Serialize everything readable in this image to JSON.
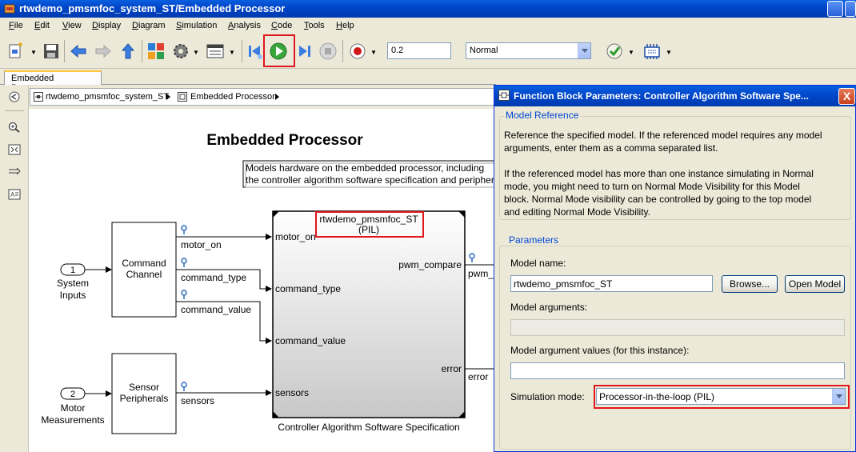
{
  "window": {
    "title": "rtwdemo_pmsmfoc_system_ST/Embedded Processor"
  },
  "menu": [
    "File",
    "Edit",
    "View",
    "Display",
    "Diagram",
    "Simulation",
    "Analysis",
    "Code",
    "Tools",
    "Help"
  ],
  "toolbar": {
    "stop_time": "0.2",
    "sim_mode": "Normal"
  },
  "tab": {
    "label": "Embedded Processor"
  },
  "breadcrumb": [
    "rtwdemo_pmsmfoc_system_ST",
    "Embedded Processor"
  ],
  "diagram": {
    "title": "Embedded Processor",
    "annotation_line1": "Models hardware on the embedded processor, including",
    "annotation_line2": "the controller algorithm software specification and peripher",
    "inport1_num": "1",
    "inport1_label_a": "System",
    "inport1_label_b": "Inputs",
    "inport2_num": "2",
    "inport2_label_a": "Motor",
    "inport2_label_b": "Measurements",
    "cmd_block_a": "Command",
    "cmd_block_b": "Channel",
    "sensor_block_a": "Sensor",
    "sensor_block_b": "Peripherals",
    "signal_motor_on": "motor_on",
    "signal_command_type": "command_type",
    "signal_command_value": "command_value",
    "signal_sensors": "sensors",
    "model_ref_name": "rtwdemo_pmsmfoc_ST",
    "model_ref_mode": "(PIL)",
    "port_in_motor_on": "motor_on",
    "port_in_command_type": "command_type",
    "port_in_command_value": "command_value",
    "port_in_sensors": "sensors",
    "port_out_pwm": "pwm_compare",
    "port_out_error": "error",
    "out_sig_pwm": "pwm_",
    "out_sig_error": "error",
    "model_block_caption": "Controller Algorithm Software Specification"
  },
  "dialog": {
    "title": "Function Block Parameters: Controller Algorithm Software Spe...",
    "close": "X",
    "group1_title": "Model Reference",
    "desc1_l1": "Reference the specified model. If the referenced model requires any model",
    "desc1_l2": "arguments, enter them as a comma separated list.",
    "desc2_l1": "If the referenced model has more than one instance simulating in Normal",
    "desc2_l2": "mode, you might need to turn on Normal Mode Visibility for this Model",
    "desc2_l3": "block. Normal Mode visibility can be controlled by going to the top model",
    "desc2_l4": "and editing Normal Mode Visibility.",
    "group2_title": "Parameters",
    "model_name_label": "Model name:",
    "model_name_value": "rtwdemo_pmsmfoc_ST",
    "browse_button": "Browse...",
    "open_model_button": "Open Model",
    "model_args_label": "Model arguments:",
    "model_args_value": "",
    "model_arg_values_label": "Model argument values (for this instance):",
    "model_arg_values_value": "",
    "sim_mode_label": "Simulation mode:",
    "sim_mode_value": "Processor-in-the-loop (PIL)"
  }
}
